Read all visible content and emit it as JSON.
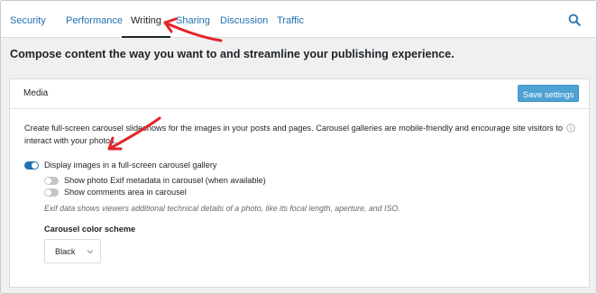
{
  "tabs": [
    {
      "label": "Security"
    },
    {
      "label": "Performance"
    },
    {
      "label": "Writing",
      "active": true
    },
    {
      "label": "Sharing"
    },
    {
      "label": "Discussion"
    },
    {
      "label": "Traffic"
    }
  ],
  "search_icon": "search-icon",
  "headline": "Compose content the way you want to and streamline your publishing experience.",
  "media": {
    "title": "Media",
    "save_button": "Save settings",
    "description": "Create full-screen carousel slideshows for the images in your posts and pages. Carousel galleries are mobile-friendly and encourage site visitors to interact with your photos.",
    "info_icon": "info-icon",
    "toggles": [
      {
        "label": "Display images in a full-screen carousel gallery",
        "on": true
      },
      {
        "label": "Show photo Exif metadata in carousel (when available)",
        "on": false
      },
      {
        "label": "Show comments area in carousel",
        "on": false
      }
    ],
    "exif_hint": "Exif data shows viewers additional technical details of a photo, like its focal length, aperture, and ISO.",
    "color_scheme": {
      "label": "Carousel color scheme",
      "value": "Black"
    }
  },
  "colors": {
    "accent": "#2271b1",
    "save_button": "#4ea1d3",
    "annotation": "#e3262b"
  }
}
